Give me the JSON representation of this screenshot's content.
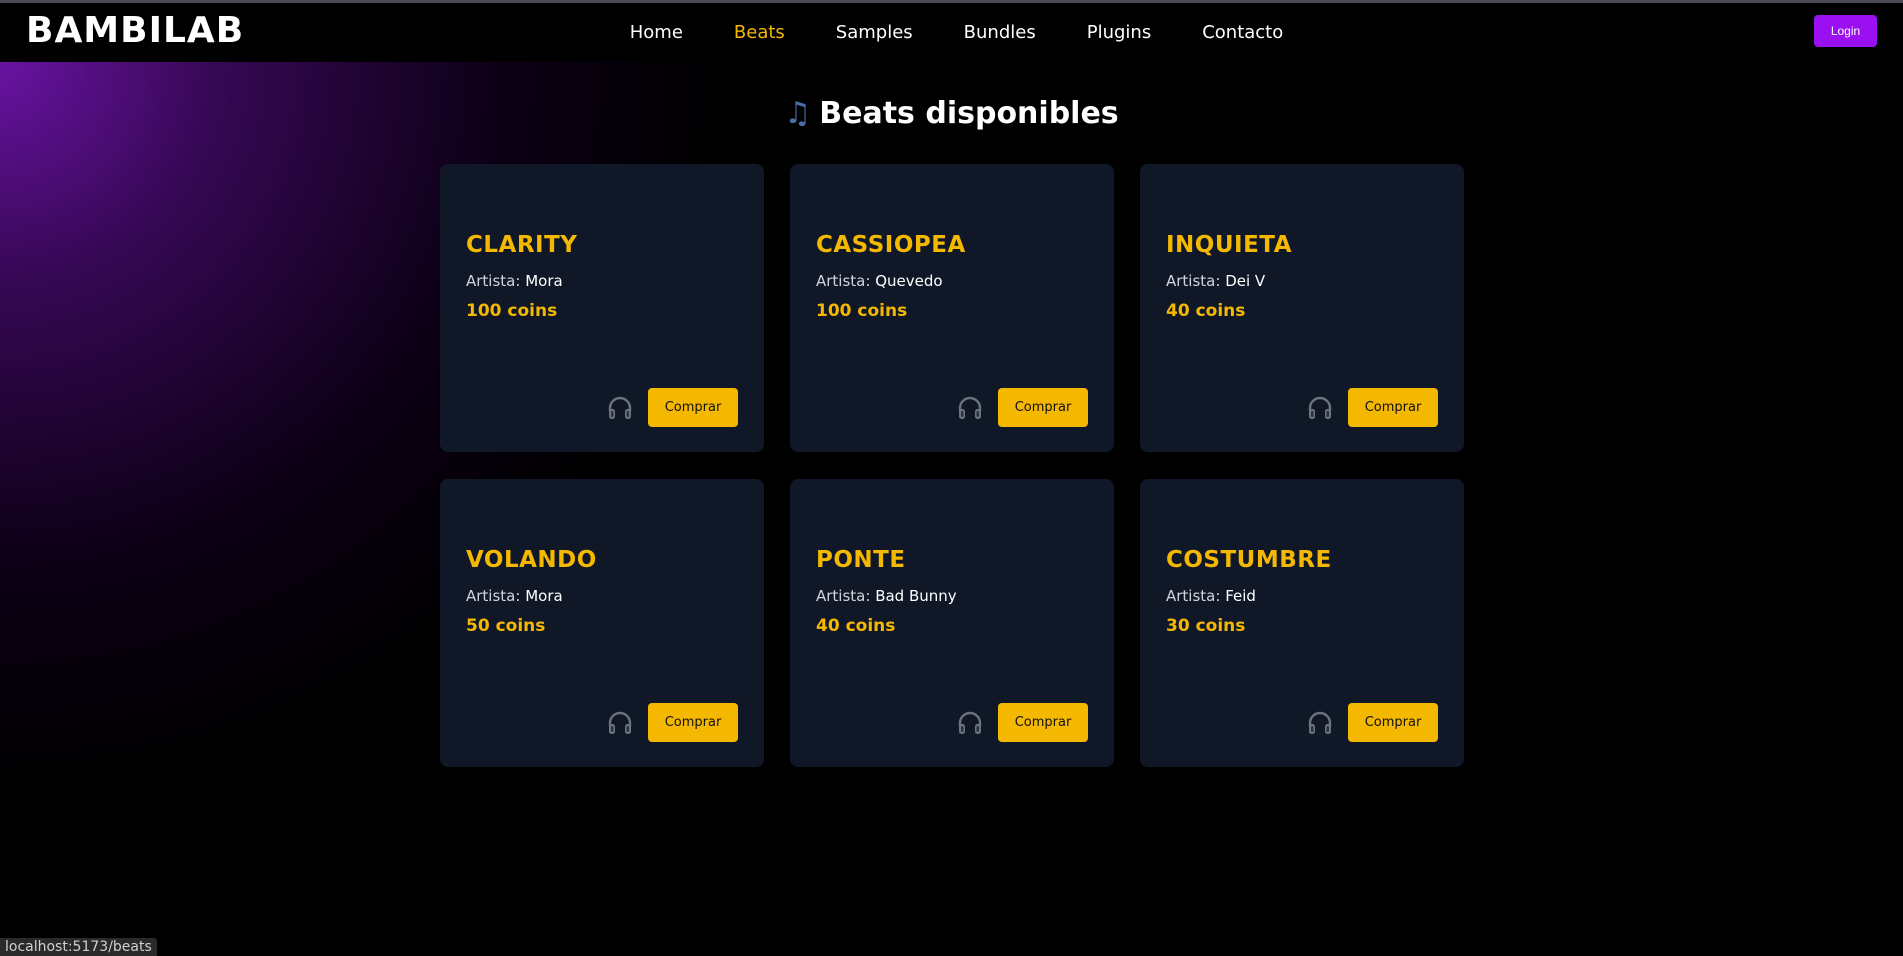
{
  "brand": "BAMBILAB",
  "nav": {
    "items": [
      {
        "label": "Home",
        "active": false
      },
      {
        "label": "Beats",
        "active": true
      },
      {
        "label": "Samples",
        "active": false
      },
      {
        "label": "Bundles",
        "active": false
      },
      {
        "label": "Plugins",
        "active": false
      },
      {
        "label": "Contacto",
        "active": false
      }
    ],
    "login_label": "Login"
  },
  "page": {
    "title_icon": "music-note-icon",
    "title": "Beats disponibles"
  },
  "beats": [
    {
      "title": "CLARITY",
      "artist_label": "Artista:",
      "artist": "Mora",
      "price": "100 coins",
      "buy_label": "Comprar"
    },
    {
      "title": "CASSIOPEA",
      "artist_label": "Artista:",
      "artist": "Quevedo",
      "price": "100 coins",
      "buy_label": "Comprar"
    },
    {
      "title": "INQUIETA",
      "artist_label": "Artista:",
      "artist": "Dei V",
      "price": "40 coins",
      "buy_label": "Comprar"
    },
    {
      "title": "VOLANDO",
      "artist_label": "Artista:",
      "artist": "Mora",
      "price": "50 coins",
      "buy_label": "Comprar"
    },
    {
      "title": "PONTE",
      "artist_label": "Artista:",
      "artist": "Bad Bunny",
      "price": "40 coins",
      "buy_label": "Comprar"
    },
    {
      "title": "COSTUMBRE",
      "artist_label": "Artista:",
      "artist": "Feid",
      "price": "30 coins",
      "buy_label": "Comprar"
    }
  ],
  "status_bar": {
    "url": "localhost:5173/beats"
  },
  "colors": {
    "accent": "#f5b800",
    "login": "#9b10f0",
    "card_bg": "#101828"
  }
}
